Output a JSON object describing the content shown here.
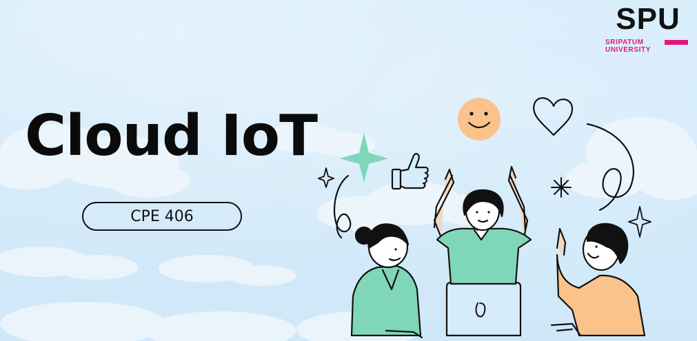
{
  "slide": {
    "title": "Cloud IoT",
    "course_code": "CPE 406"
  },
  "logo": {
    "wordmark": "SPU",
    "line1": "SRIPATUM",
    "line2": "UNIVERSITY"
  },
  "colors": {
    "sky": "#cfe8f8",
    "cloud": "#eef6fc",
    "brand_pink": "#e8127f",
    "mint": "#7fd6b8",
    "peach": "#f9c38b",
    "ink": "#111111"
  },
  "illustration": {
    "subject": "team-celebrating-around-laptop",
    "icons": [
      "smiley-icon",
      "heart-icon",
      "thumbs-up-icon",
      "sparkle-icon",
      "star-icon"
    ]
  }
}
